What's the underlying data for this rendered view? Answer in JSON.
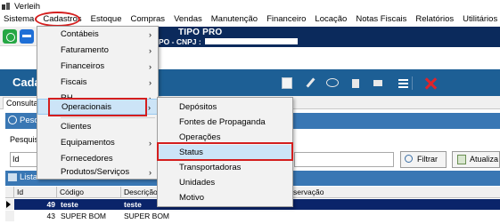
{
  "window": {
    "title": "Verleih"
  },
  "menubar": {
    "items": [
      "Sistema",
      "Cadastros",
      "Estoque",
      "Compras",
      "Vendas",
      "Manutenção",
      "Financeiro",
      "Locação",
      "Notas Fiscais",
      "Relatórios",
      "Utilitários"
    ]
  },
  "company": {
    "name": "TIPO PRO",
    "cnpj_label": "PO - CNPJ :"
  },
  "form": {
    "title": "Cada",
    "tab": "Consulta",
    "search_panel": "Pesq",
    "search_label": "Pesquisa",
    "id_field": "Id",
    "filter_button": "Filtrar",
    "update_button": "Atualiza",
    "list_panel": "Lista"
  },
  "grid": {
    "columns": [
      "Id",
      "Código",
      "Descrição",
      "servação"
    ],
    "rows": [
      {
        "id": "49",
        "code": "teste",
        "desc": "teste"
      },
      {
        "id": "43",
        "code": "SUPER BOM",
        "desc": "SUPER BOM"
      }
    ]
  },
  "cadastros_menu": {
    "items": [
      "Contábeis",
      "Faturamento",
      "Financeiros",
      "Fiscais",
      "RH",
      "Operacionais",
      "Clientes",
      "Equipamentos",
      "Fornecedores",
      "Produtos/Serviços"
    ],
    "arrow": "›"
  },
  "operacionais_menu": {
    "items": [
      "Depósitos",
      "Fontes de Propaganda",
      "Operações",
      "Status",
      "Transportadoras",
      "Unidades",
      "Motivo"
    ]
  },
  "colors": {
    "highlight_red": "#d41e1e",
    "header_blue": "#1d5f95",
    "panel_blue": "#3977b4",
    "company_navy": "#0b2a5c"
  }
}
